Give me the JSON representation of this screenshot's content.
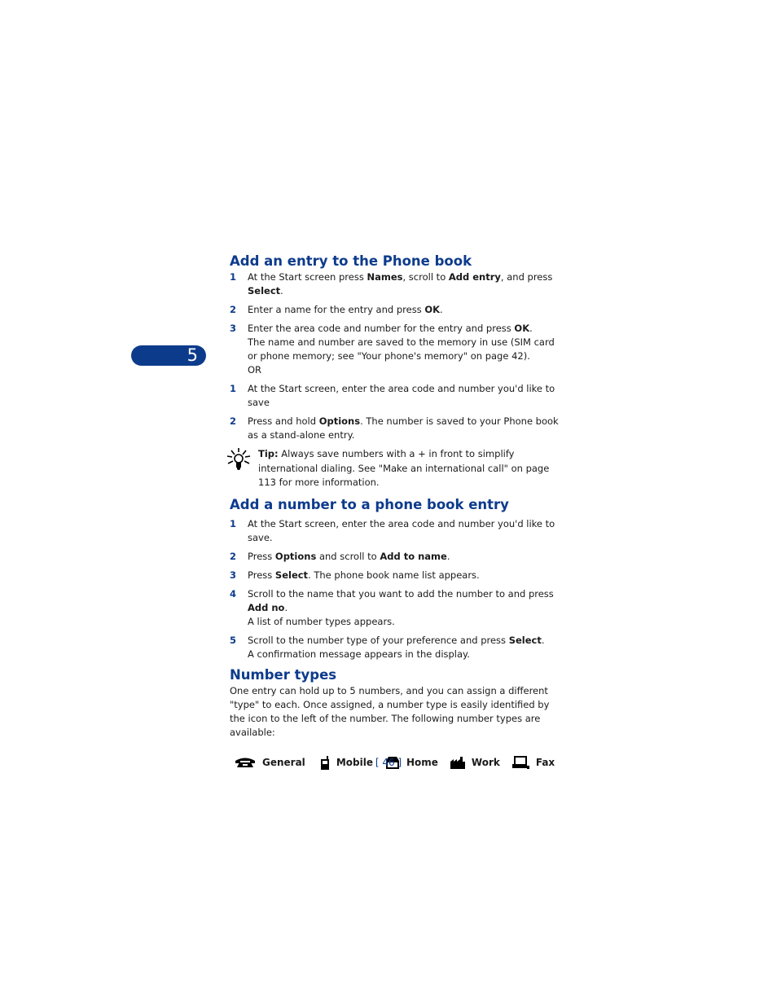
{
  "chapter": {
    "number": "5"
  },
  "sections": [
    {
      "title": "Add an entry to the Phone book",
      "steps": [
        {
          "num": "1",
          "html_parts": [
            "At the Start screen press ",
            "Names",
            ", scroll to ",
            "Add entry",
            ", and press ",
            "Select",
            "."
          ]
        },
        {
          "num": "2",
          "html_parts": [
            "Enter a name for the entry and press ",
            "OK",
            "."
          ]
        },
        {
          "num": "3",
          "html_parts": [
            "Enter the area code and number for the entry and press ",
            "OK",
            "."
          ],
          "extra": [
            "The name and number are saved to the memory in use (SIM card or phone memory; see \"Your phone's memory\" on page 42).",
            "OR"
          ]
        },
        {
          "num": "1",
          "html_parts": [
            "At the Start screen, enter the area code and number you'd like to save"
          ]
        },
        {
          "num": "2",
          "html_parts": [
            "Press and hold ",
            "Options",
            ". The number is saved to your Phone book as a stand-alone entry."
          ]
        }
      ],
      "tip": {
        "label": "Tip:",
        "text": " Always save numbers with a + in front to simplify international dialing. See \"Make an international call\" on page 113 for more information."
      }
    },
    {
      "title": "Add a number to a phone book entry",
      "steps": [
        {
          "num": "1",
          "html_parts": [
            "At the Start screen, enter the area code and number you'd like to save."
          ]
        },
        {
          "num": "2",
          "html_parts": [
            "Press ",
            "Options",
            " and scroll to ",
            "Add to name",
            "."
          ]
        },
        {
          "num": "3",
          "html_parts": [
            "Press ",
            "Select",
            ". The phone book name list appears."
          ]
        },
        {
          "num": "4",
          "html_parts": [
            "Scroll to the name that you want to add the number to and press ",
            "Add no",
            "."
          ],
          "extra": [
            "A list of number types appears."
          ]
        },
        {
          "num": "5",
          "html_parts": [
            "Scroll to the number type of your preference and press ",
            "Select",
            "."
          ],
          "extra": [
            "A confirmation message appears in the display."
          ]
        }
      ]
    },
    {
      "title": "Number types",
      "paragraph": "One entry can hold up to 5 numbers, and you can assign a different \"type\" to each. Once assigned, a number type is easily identified by the icon to the left of the number. The following number types are available:",
      "types": [
        {
          "icon": "telephone-icon",
          "label": "General"
        },
        {
          "icon": "mobile-phone-icon",
          "label": "Mobile"
        },
        {
          "icon": "home-icon",
          "label": "Home"
        },
        {
          "icon": "factory-icon",
          "label": "Work"
        },
        {
          "icon": "fax-icon",
          "label": "Fax"
        }
      ]
    }
  ],
  "footer": {
    "page_number": "[ 46 ]"
  },
  "colors": {
    "accent": "#0d3b8c",
    "text": "#1a1a1a"
  }
}
